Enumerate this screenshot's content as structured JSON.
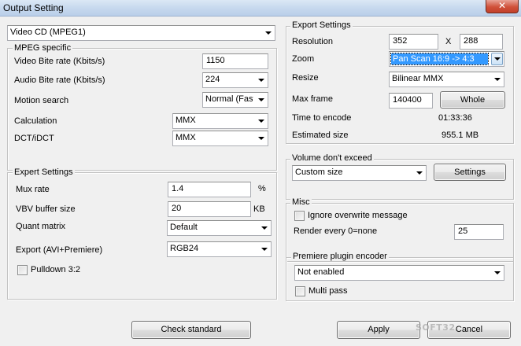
{
  "window": {
    "title": "Output Setting",
    "close_glyph": "✕"
  },
  "format": {
    "selected": "Video CD (MPEG1)"
  },
  "mpeg": {
    "group_label": "MPEG specific",
    "video_bitrate_label": "Video Bite rate (Kbits/s)",
    "video_bitrate_value": "1150",
    "audio_bitrate_label": "Audio Bite rate (Kbits/s)",
    "audio_bitrate_value": "224",
    "motion_search_label": "Motion search",
    "motion_search_value": "Normal (Fast)",
    "calculation_label": "Calculation",
    "calculation_value": "MMX",
    "dct_label": "DCT/iDCT",
    "dct_value": "MMX"
  },
  "expert": {
    "group_label": "Expert Settings",
    "mux_rate_label": "Mux rate",
    "mux_rate_value": "1.4",
    "mux_rate_unit": "%",
    "vbv_label": "VBV buffer size",
    "vbv_value": "20",
    "vbv_unit": "KB",
    "quant_label": "Quant matrix",
    "quant_value": "Default",
    "export_label": "Export (AVI+Premiere)",
    "export_value": "RGB24",
    "pulldown_label": "Pulldown 3:2",
    "pulldown_checked": false
  },
  "export": {
    "group_label": "Export Settings",
    "resolution_label": "Resolution",
    "res_width": "352",
    "res_sep": "X",
    "res_height": "288",
    "zoom_label": "Zoom",
    "zoom_value": "Pan Scan 16:9 -> 4:3",
    "resize_label": "Resize",
    "resize_value": "Bilinear MMX",
    "max_frame_label": "Max frame",
    "max_frame_value": "140400",
    "whole_button": "Whole",
    "time_label": "Time to encode",
    "time_value": "01:33:36",
    "size_label": "Estimated size",
    "size_value": "955.1 MB"
  },
  "volume": {
    "group_label": "Volume don't exceed",
    "value": "Custom size",
    "settings_button": "Settings"
  },
  "misc": {
    "group_label": "Misc",
    "ignore_label": "Ignore overwrite message",
    "ignore_checked": false,
    "render_label": "Render every 0=none",
    "render_value": "25"
  },
  "premiere": {
    "group_label": "Premiere plugin encoder",
    "value": "Not enabled",
    "multipass_label": "Multi pass",
    "multipass_checked": false
  },
  "footer": {
    "check_button": "Check standard",
    "apply_button": "Apply",
    "cancel_button": "Cancel"
  },
  "watermark_text": "SOFT32"
}
